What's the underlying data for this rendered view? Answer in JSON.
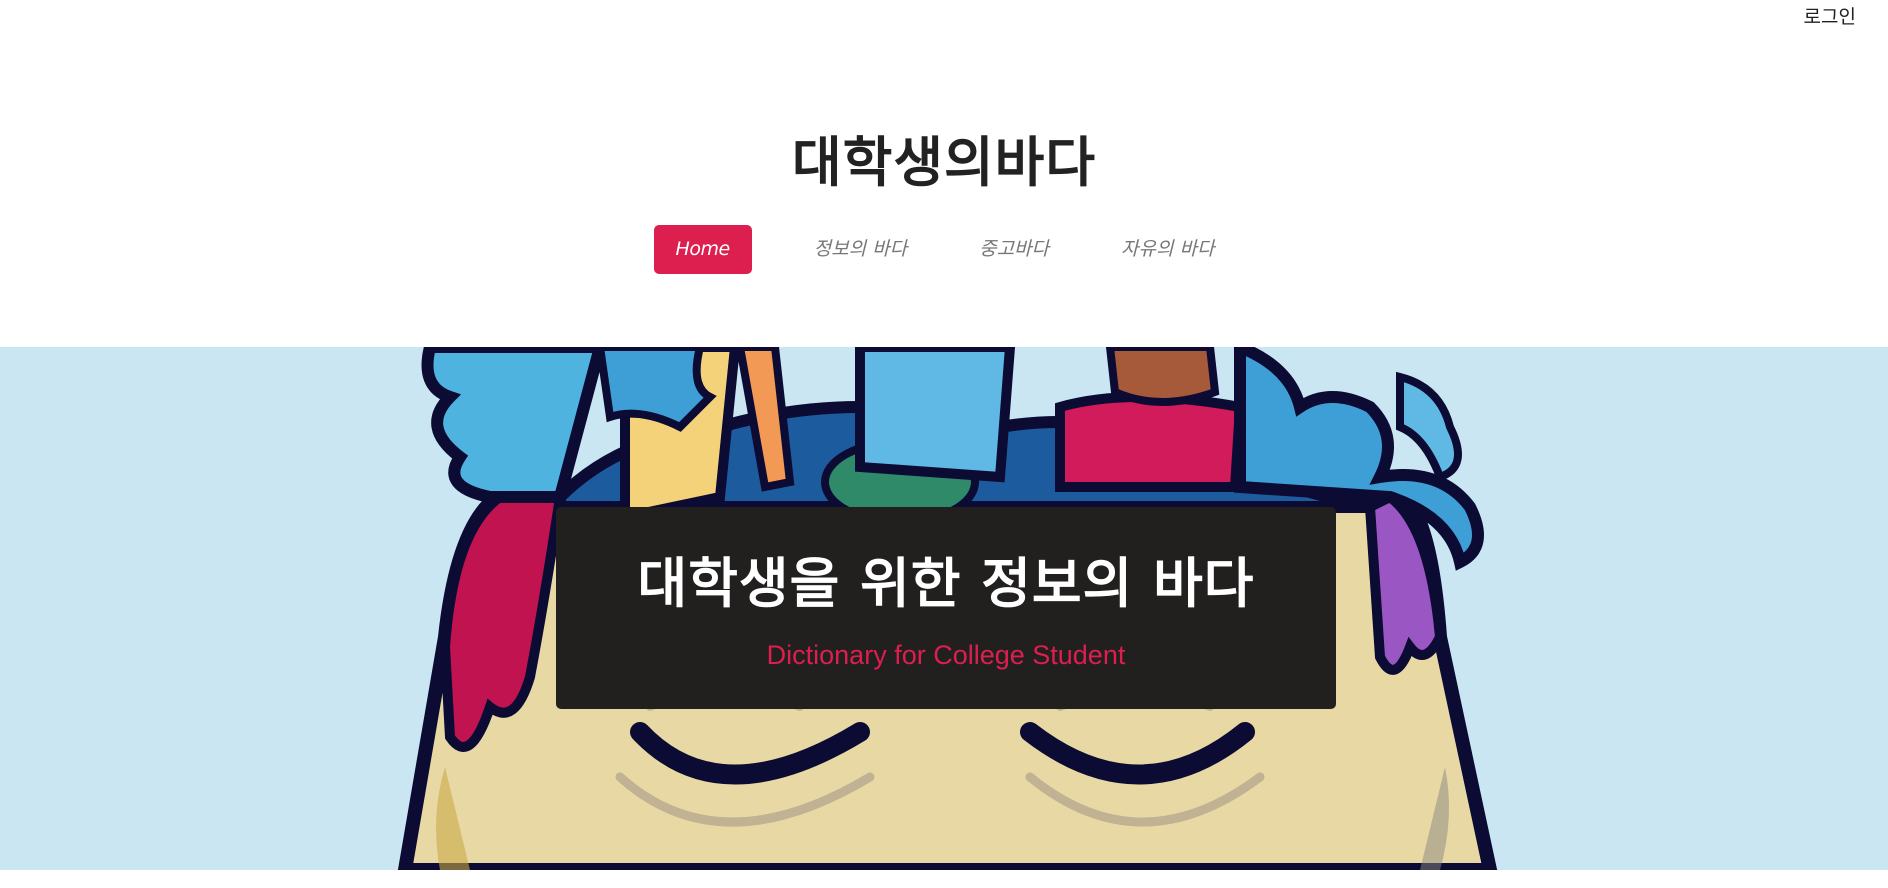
{
  "header": {
    "login_label": "로그인",
    "site_title": "대학생의바다"
  },
  "nav": {
    "items": [
      {
        "label": "Home",
        "active": true
      },
      {
        "label": "정보의 바다",
        "active": false
      },
      {
        "label": "중고바다",
        "active": false
      },
      {
        "label": "자유의 바다",
        "active": false
      }
    ]
  },
  "hero": {
    "heading": "대학생을 위한 정보의 바다",
    "subheading": "Dictionary for College Student"
  },
  "colors": {
    "accent": "#dc1f4e",
    "hero_background": "#cae6f2",
    "hero_box": "#221f1f"
  }
}
